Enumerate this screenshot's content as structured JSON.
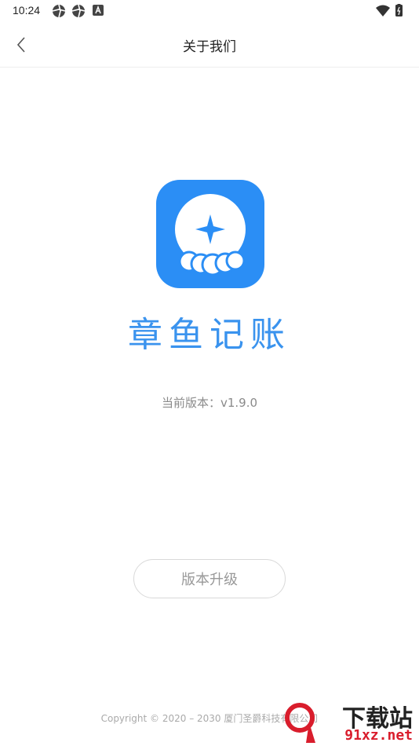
{
  "status_bar": {
    "time": "10:24",
    "left_icons": [
      "aperture-icon",
      "aperture-icon",
      "a-badge-icon"
    ],
    "right_icons": [
      "wifi-icon",
      "battery-icon"
    ]
  },
  "header": {
    "title": "关于我们",
    "back_icon": "chevron-left-icon"
  },
  "app": {
    "name": "章鱼记账",
    "logo_icon": "octopus-logo-icon",
    "brand_color": "#2b8ef5",
    "version_text": "当前版本：v1.9.0"
  },
  "actions": {
    "upgrade_label": "版本升级"
  },
  "footer": {
    "copyright": "Copyright © 2020 – 2030 厦门圣爵科技有限公司"
  },
  "watermark": {
    "line1": "下载站",
    "line2": "91xz.net"
  }
}
